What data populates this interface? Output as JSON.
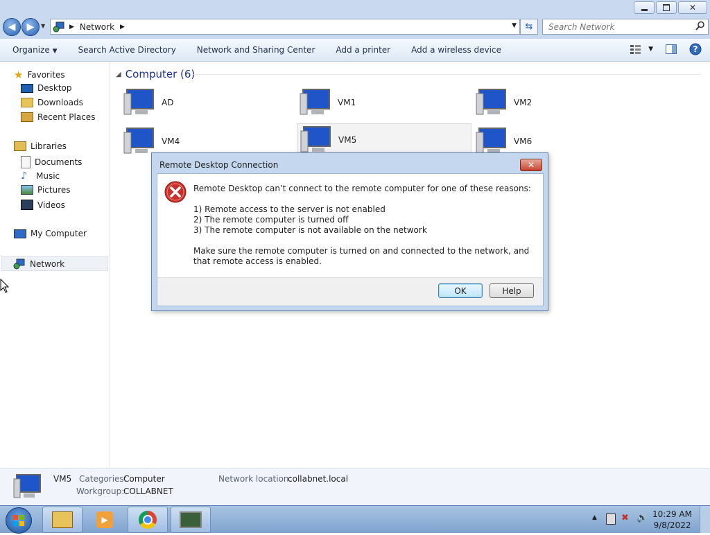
{
  "window": {
    "minimize_icon": "minimize-icon",
    "maximize_icon": "restore-icon",
    "close_icon": "close-icon"
  },
  "address": {
    "breadcrumb": "Network",
    "search_placeholder": "Search Network"
  },
  "toolbar": {
    "organize": "Organize",
    "search_ad": "Search Active Directory",
    "network_sharing": "Network and Sharing Center",
    "add_printer": "Add a printer",
    "add_wireless": "Add a wireless device"
  },
  "nav": {
    "favorites": "Favorites",
    "desktop": "Desktop",
    "downloads": "Downloads",
    "recent": "Recent Places",
    "libraries": "Libraries",
    "documents": "Documents",
    "music": "Music",
    "pictures": "Pictures",
    "videos": "Videos",
    "my_computer": "My Computer",
    "network": "Network"
  },
  "content": {
    "group_header": "Computer (6)",
    "computers": [
      "AD",
      "VM1",
      "VM2",
      "VM4",
      "VM5",
      "VM6"
    ]
  },
  "details": {
    "name": "VM5",
    "categories_label": "Categories:",
    "categories_value": "Computer",
    "workgroup_label": "Workgroup:",
    "workgroup_value": "COLLABNET",
    "location_label": "Network location:",
    "location_value": "collabnet.local"
  },
  "dialog": {
    "title": "Remote Desktop Connection",
    "line1": "Remote Desktop can’t connect to the remote computer for one of these reasons:",
    "reason1": "1) Remote access to the server is not enabled",
    "reason2": "2) The remote computer is turned off",
    "reason3": "3) The remote computer is not available on the network",
    "line2": "Make sure the remote computer is turned on and connected to the network, and that remote access is enabled.",
    "ok": "OK",
    "help": "Help"
  },
  "taskbar": {
    "time": "10:29 AM",
    "date": "9/8/2022"
  },
  "colors": {
    "accent": "#2a62b3",
    "error": "#c8302a",
    "group_header": "#1e3287"
  }
}
